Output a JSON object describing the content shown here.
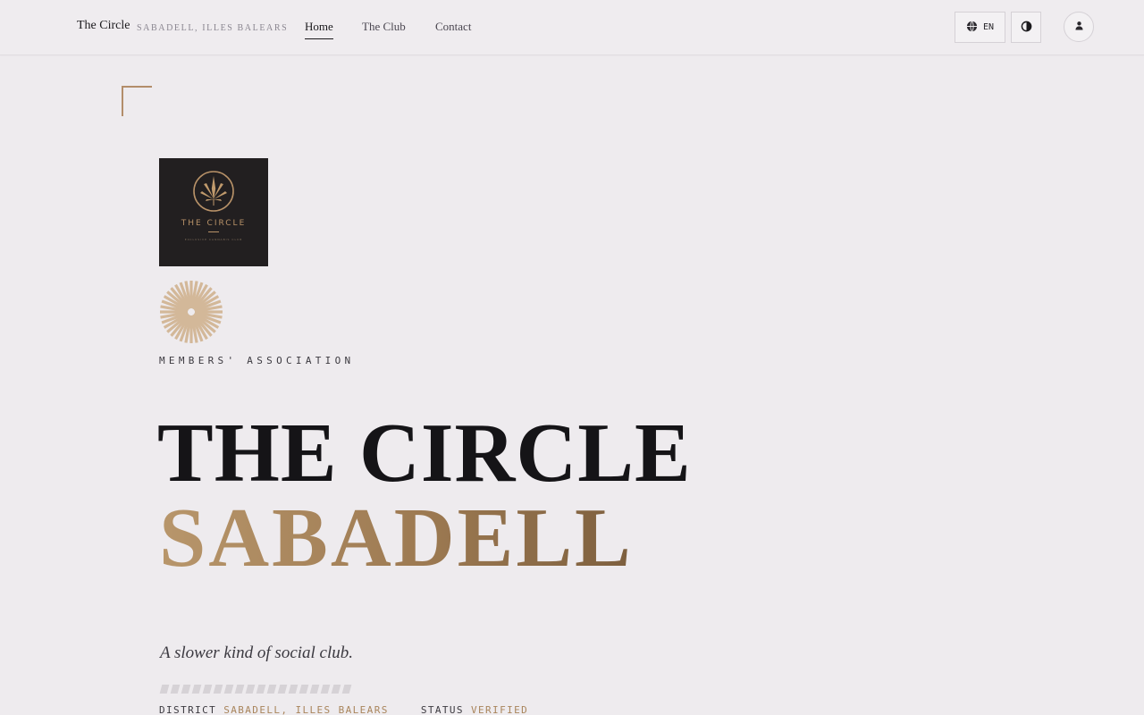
{
  "header": {
    "brand": "The Circle",
    "location": "SABADELL, ILLES BALEARS",
    "nav": [
      "Home",
      "The Club",
      "Contact"
    ],
    "language": "EN"
  },
  "logo": {
    "name": "THE CIRCLE",
    "sub": "EXCLUSIVE CANNABIS CLUB"
  },
  "hero": {
    "eyebrow": "MEMBERS' ASSOCIATION",
    "title_line1": "THE CIRCLE",
    "title_line2": "SABADELL",
    "tagline": "A slower kind of social club."
  },
  "meta": {
    "district_label": "DISTRICT",
    "district_value": "SABADELL, ILLES BALEARS",
    "status_label": "STATUS",
    "status_value": "VERIFIED"
  },
  "colors": {
    "accent_gold": "#a9855c",
    "background": "#eeebee",
    "text": "#1b1a1d"
  },
  "icons": {
    "language": "globe-icon",
    "theme": "contrast-icon",
    "account": "user-icon"
  }
}
